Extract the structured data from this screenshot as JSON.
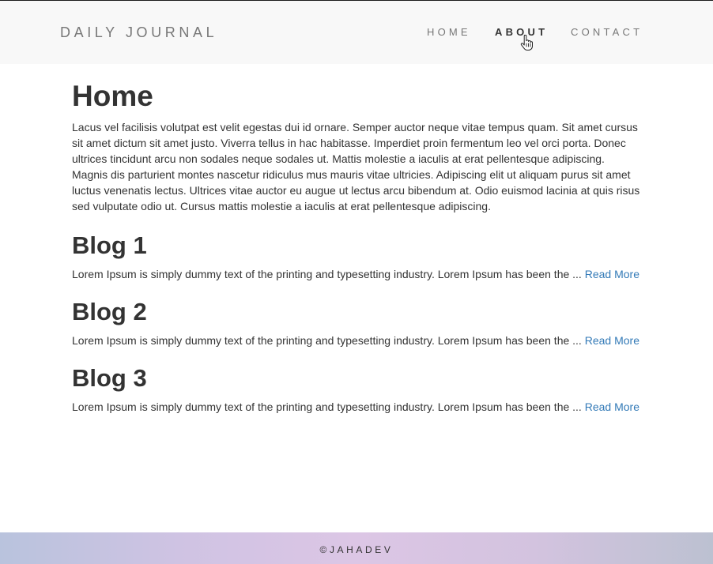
{
  "navbar": {
    "brand": "DAILY JOURNAL",
    "links": [
      "HOME",
      "ABOUT",
      "CONTACT"
    ]
  },
  "main": {
    "title": "Home",
    "intro": "Lacus vel facilisis volutpat est velit egestas dui id ornare. Semper auctor neque vitae tempus quam. Sit amet cursus sit amet dictum sit amet justo. Viverra tellus in hac habitasse. Imperdiet proin fermentum leo vel orci porta. Donec ultrices tincidunt arcu non sodales neque sodales ut. Mattis molestie a iaculis at erat pellentesque adipiscing. Magnis dis parturient montes nascetur ridiculus mus mauris vitae ultricies. Adipiscing elit ut aliquam purus sit amet luctus venenatis lectus. Ultrices vitae auctor eu augue ut lectus arcu bibendum at. Odio euismod lacinia at quis risus sed vulputate odio ut. Cursus mattis molestie a iaculis at erat pellentesque adipiscing.",
    "posts": [
      {
        "title": "Blog 1",
        "excerpt": "Lorem Ipsum is simply dummy text of the printing and typesetting industry. Lorem Ipsum has been the ... ",
        "link": "Read More"
      },
      {
        "title": "Blog 2",
        "excerpt": "Lorem Ipsum is simply dummy text of the printing and typesetting industry. Lorem Ipsum has been the ... ",
        "link": "Read More"
      },
      {
        "title": "Blog 3",
        "excerpt": "Lorem Ipsum is simply dummy text of the printing and typesetting industry. Lorem Ipsum has been the ... ",
        "link": "Read More"
      }
    ]
  },
  "footer": {
    "copyright": "©JAHADEV"
  },
  "colors": {
    "navbar_bg": "#f8f8f8",
    "link": "#337ab7",
    "text": "#333333",
    "nav_text": "#777777"
  },
  "icons": {
    "cursor": "hand-pointer-icon"
  }
}
